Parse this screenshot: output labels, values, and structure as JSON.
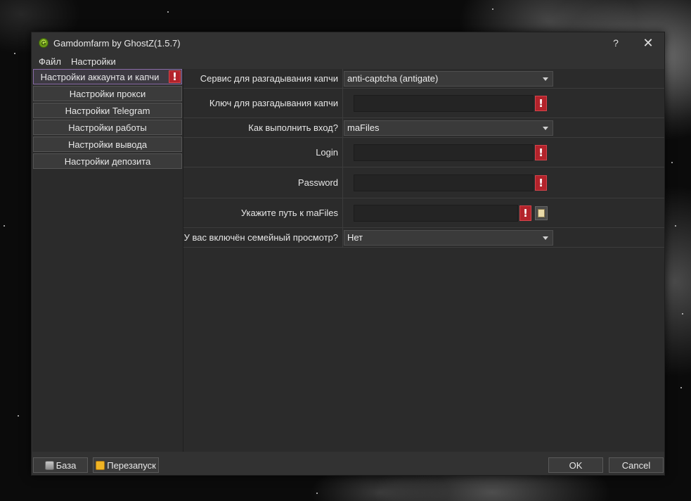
{
  "window": {
    "title": "Gamdomfarm by GhostZ(1.5.7)",
    "help": "?",
    "close": "✕",
    "logo_letter": "G"
  },
  "menu": [
    "Файл",
    "Настройки"
  ],
  "sidebar": {
    "items": [
      {
        "label": "Настройки аккаунта и капчи",
        "active": true,
        "warning": true
      },
      {
        "label": "Настройки прокси"
      },
      {
        "label": "Настройки Telegram"
      },
      {
        "label": "Настройки работы"
      },
      {
        "label": "Настройки вывода"
      },
      {
        "label": "Настройки депозита"
      }
    ]
  },
  "form": {
    "captcha_service": {
      "label": "Сервис для разгадывания капчи",
      "value": "anti-captcha (antigate)"
    },
    "captcha_key": {
      "label": "Ключ для разгадывания капчи",
      "value": ""
    },
    "login_method": {
      "label": "Как выполнить вход?",
      "value": "maFiles"
    },
    "login": {
      "label": "Login",
      "value": ""
    },
    "password": {
      "label": "Password",
      "value": ""
    },
    "mafiles_path": {
      "label": "Укажите путь к maFiles",
      "value": ""
    },
    "family_view": {
      "label": "У вас включён семейный просмотр?",
      "value": "Нет"
    }
  },
  "warning_glyph": "!",
  "footer": {
    "db_label": "База",
    "restart_label": "Перезапуск",
    "ok_label": "OK",
    "cancel_label": "Cancel"
  },
  "colors": {
    "warning": "#b3232b",
    "active_border": "#8a6ca8",
    "window_bg": "#323232",
    "panel_bg": "#2b2b2b"
  }
}
